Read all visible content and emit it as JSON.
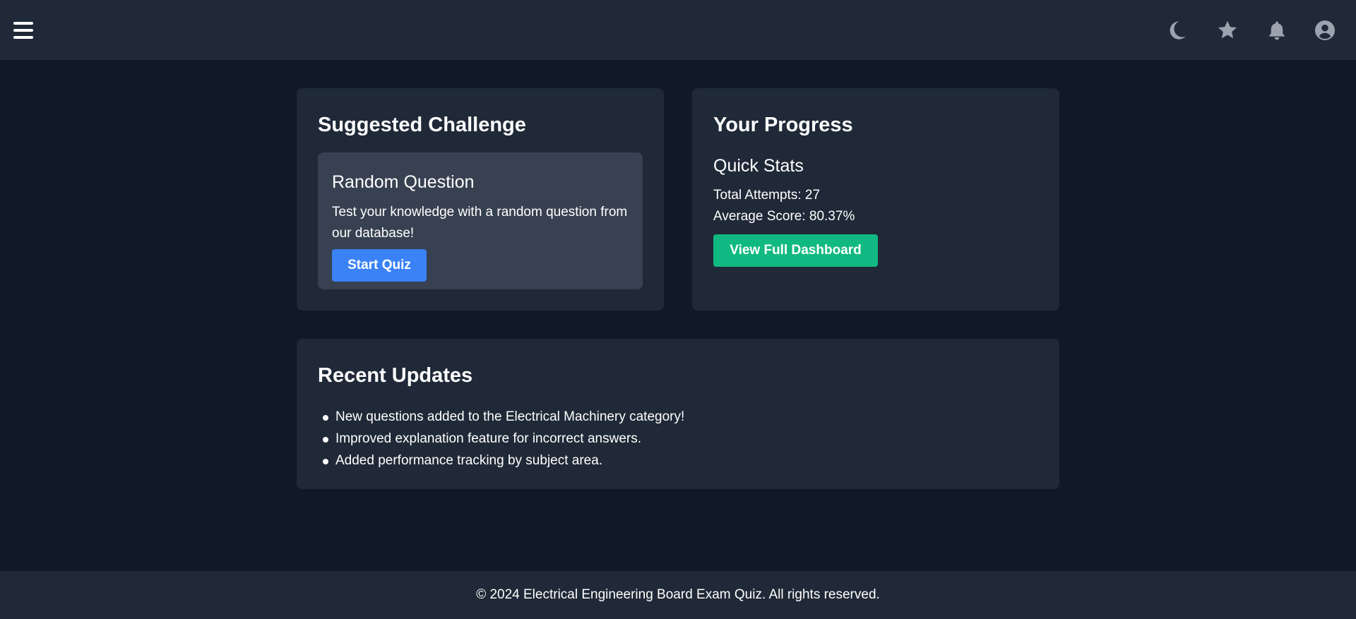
{
  "header": {
    "icons": [
      "menu-icon",
      "moon-icon",
      "star-icon",
      "bell-icon",
      "user-circle-icon"
    ]
  },
  "suggested": {
    "title": "Suggested Challenge",
    "card_title": "Random Question",
    "card_text": "Test your knowledge with a random question from our database!",
    "button_label": "Start Quiz"
  },
  "progress": {
    "title": "Your Progress",
    "subtitle": "Quick Stats",
    "total_attempts": "Total Attempts: 27",
    "average_score": "Average Score: 80.37%",
    "button_label": "View Full Dashboard"
  },
  "updates": {
    "title": "Recent Updates",
    "items": [
      "New questions added to the Electrical Machinery category!",
      "Improved explanation feature for incorrect answers.",
      "Added performance tracking by subject area."
    ]
  },
  "footer": {
    "text": "© 2024 Electrical Engineering Board Exam Quiz. All rights reserved."
  },
  "colors": {
    "background": "#111827",
    "surface": "#1f2937",
    "inner_surface": "#374151",
    "primary_button": "#3b82f6",
    "success_button": "#10b981",
    "icon": "#9ca3af"
  }
}
